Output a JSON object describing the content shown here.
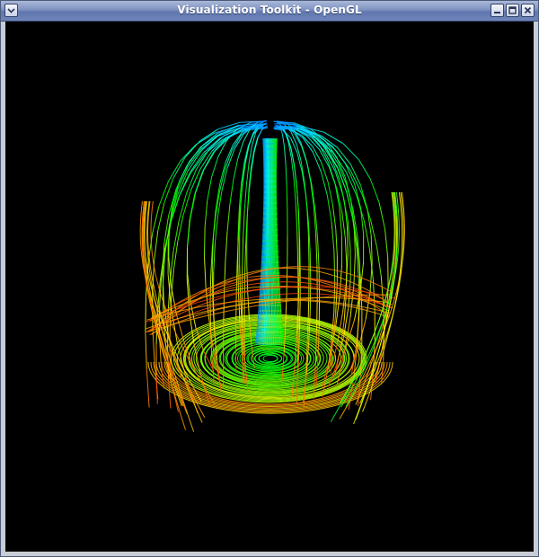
{
  "window": {
    "title": "Visualization Toolkit - OpenGL"
  },
  "titlebar": {
    "menu_icon": "chevron-down-icon",
    "minimize_icon": "minimize-icon",
    "maximize_icon": "maximize-icon",
    "close_icon": "close-icon"
  },
  "render": {
    "background": "#000000",
    "subject": "streamlines",
    "colormap": [
      "#0000ff",
      "#00ffff",
      "#00ff00",
      "#ffff00",
      "#ff0000"
    ]
  }
}
